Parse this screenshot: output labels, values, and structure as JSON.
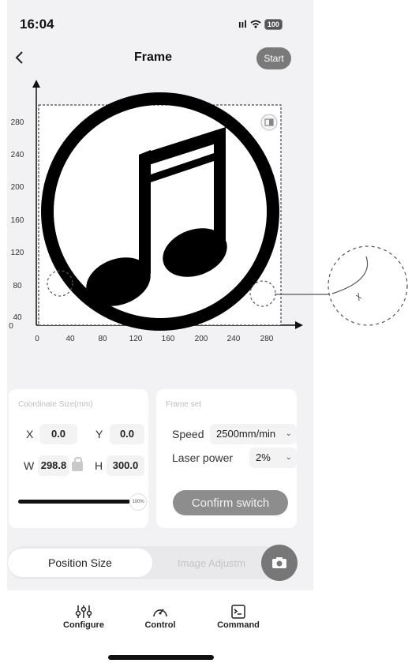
{
  "status_bar": {
    "time": "16:04",
    "signal": "ııl",
    "battery": "100"
  },
  "header": {
    "back_icon": "chevron-left-icon",
    "title": "Frame",
    "start_label": "Start"
  },
  "plot": {
    "y_ticks": [
      "280",
      "240",
      "200",
      "160",
      "120",
      "80",
      "40",
      "0"
    ],
    "x_ticks": [
      "0",
      "40",
      "80",
      "120",
      "160",
      "200",
      "240",
      "280"
    ],
    "image_icon": "music-note-icon",
    "corner_icon": "frame-toggle-icon"
  },
  "coordinate": {
    "title": "Coordinate Size(mm)",
    "x_label": "X",
    "x_value": "0.0",
    "y_label": "Y",
    "y_value": "0.0",
    "w_label": "W",
    "w_value": "298.8",
    "h_label": "H",
    "h_value": "300.0",
    "slider_label": "100%",
    "slider_fraction": 1.0
  },
  "frame_set": {
    "title": "Frame set",
    "speed_label": "Speed",
    "speed_value": "2500mm/min",
    "power_label": "Laser power",
    "power_value": "2%",
    "confirm_label": "Confirm switch"
  },
  "tabs": {
    "position_size": "Position Size",
    "image_adjust": "Image Adjustm"
  },
  "bottom_nav": [
    {
      "label": "Configure",
      "icon": "sliders-icon"
    },
    {
      "label": "Control",
      "icon": "gauge-icon"
    },
    {
      "label": "Command",
      "icon": "terminal-icon"
    }
  ],
  "colors": {
    "background": "#f2f2f4",
    "button_gray": "#7a7a7a",
    "card": "#ffffff"
  }
}
